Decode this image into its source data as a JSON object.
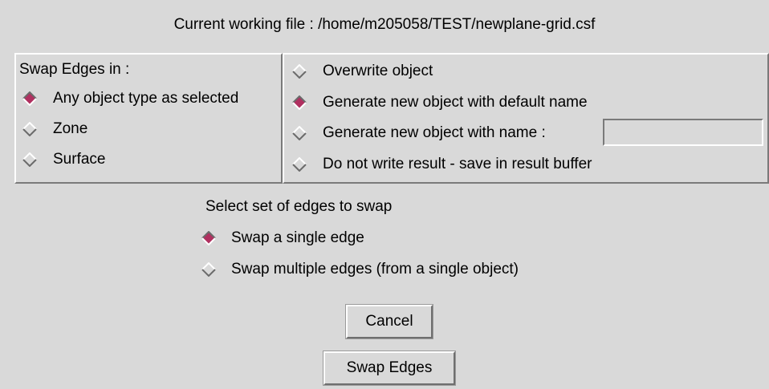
{
  "header": {
    "working_file": "Current working file : /home/m205058/TEST/newplane-grid.csf"
  },
  "swap_in": {
    "heading": "Swap Edges in :",
    "options": [
      {
        "label": "Any object type as selected",
        "selected": true
      },
      {
        "label": "Zone",
        "selected": false
      },
      {
        "label": "Surface",
        "selected": false
      }
    ]
  },
  "output": {
    "options": [
      {
        "label": "Overwrite object",
        "selected": false
      },
      {
        "label": "Generate new object with default name",
        "selected": true
      },
      {
        "label": "Generate new object with name :",
        "selected": false
      },
      {
        "label": "Do not write result - save in result buffer",
        "selected": false
      }
    ],
    "name_value": ""
  },
  "edge_set": {
    "heading": "Select set of edges to swap",
    "options": [
      {
        "label": "Swap a single edge",
        "selected": true
      },
      {
        "label": "Swap multiple edges (from a single object)",
        "selected": false
      }
    ]
  },
  "buttons": {
    "cancel": "Cancel",
    "swap": "Swap Edges"
  },
  "colors": {
    "background": "#d9d9d9",
    "radio_selected": "#b03060",
    "radio_unselected": "#d9d9d9"
  }
}
